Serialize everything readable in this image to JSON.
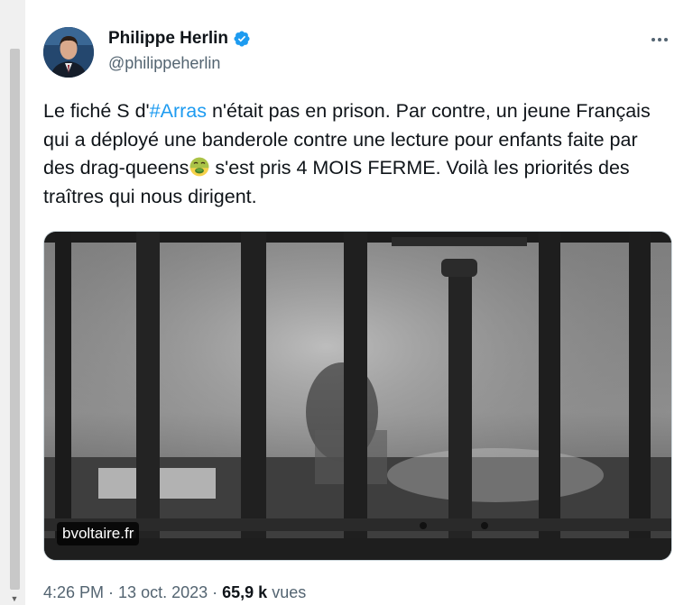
{
  "tweet": {
    "author": {
      "display_name": "Philippe Herlin",
      "handle": "@philippeherlin",
      "verified": true
    },
    "text": {
      "before_hashtag": "Le fiché S d'",
      "hashtag": "#Arras",
      "after_hashtag": " n'était pas en prison. Par contre, un jeune Français qui a déployé une banderole contre une lecture pour enfants faite par des drag-queens",
      "emoji": "nauseated-face-emoji",
      "after_emoji": " s'est pris 4 MOIS FERME. Voilà les priorités des traîtres qui nous dirigent."
    },
    "media": {
      "source_label": "bvoltaire.fr"
    },
    "meta": {
      "time": "4:26 PM",
      "separator1": " · ",
      "date": "13 oct. 2023",
      "separator2": " · ",
      "views_count": "65,9 k",
      "views_label": " vues"
    }
  },
  "colors": {
    "accent": "#1d9bf0",
    "text_primary": "#0f1419",
    "text_secondary": "#536471"
  }
}
